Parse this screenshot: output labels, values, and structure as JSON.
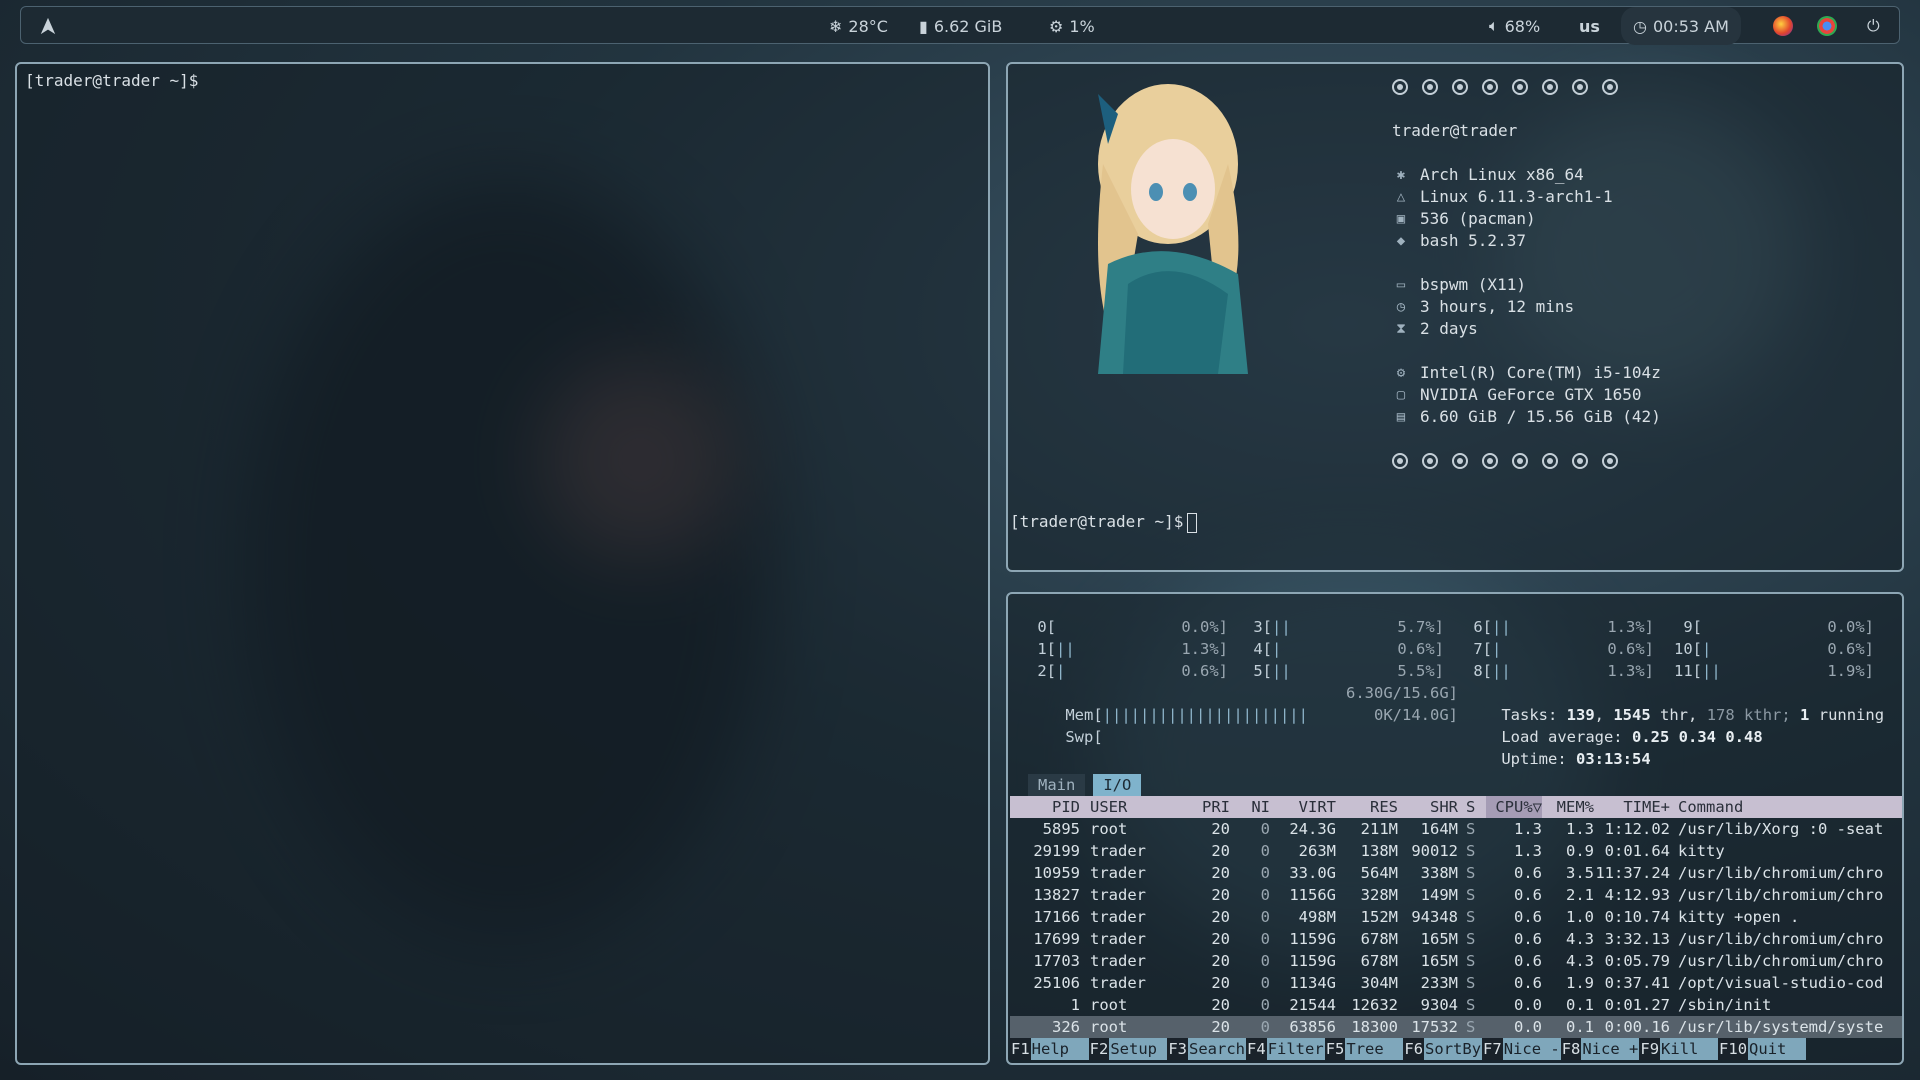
{
  "topbar": {
    "temperature": "28°C",
    "memory": "6.62 GiB",
    "cpu": "1%",
    "volume": "68%",
    "keyboard_layout": "us",
    "clock": "00:53 AM",
    "icons": [
      "arch-logo-icon",
      "snowflake-icon",
      "memory-icon",
      "cpu-icon",
      "volume-icon",
      "clock-icon",
      "firefox-icon",
      "chrome-icon",
      "power-icon"
    ]
  },
  "left_terminal": {
    "prompt": "[trader@trader ~]$"
  },
  "fetch": {
    "user_host": "trader@trader",
    "lines": [
      "Arch Linux x86_64",
      "Linux 6.11.3-arch1-1",
      "536 (pacman)",
      "bash 5.2.37",
      "bspwm (X11)",
      "3 hours, 12 mins",
      "2 days",
      "Intel(R) Core(TM) i5-104z",
      "NVIDIA GeForce GTX 1650",
      "6.60 GiB / 15.56 GiB (42)"
    ],
    "prompt": "[trader@trader ~]$"
  },
  "htop": {
    "cpus": [
      {
        "id": "0",
        "bars": "",
        "pct": "0.0%"
      },
      {
        "id": "1",
        "bars": "||",
        "pct": "1.3%"
      },
      {
        "id": "2",
        "bars": "|",
        "pct": "0.6%"
      },
      {
        "id": "3",
        "bars": "||",
        "pct": "5.7%"
      },
      {
        "id": "4",
        "bars": "|",
        "pct": "0.6%"
      },
      {
        "id": "5",
        "bars": "||",
        "pct": "5.5%"
      },
      {
        "id": "6",
        "bars": "||",
        "pct": "1.3%"
      },
      {
        "id": "7",
        "bars": "|",
        "pct": "0.6%"
      },
      {
        "id": "8",
        "bars": "||",
        "pct": "1.3%"
      },
      {
        "id": "9",
        "bars": "",
        "pct": "0.0%"
      },
      {
        "id": "10",
        "bars": "|",
        "pct": "0.6%"
      },
      {
        "id": "11",
        "bars": "||",
        "pct": "1.9%"
      }
    ],
    "mem_label": "Mem",
    "mem_bars": "||||||||||||||||||||||",
    "mem_value": "6.30G/15.6G",
    "swp_label": "Swp",
    "swp_value": "0K/14.0G",
    "tasks_prefix": "Tasks:",
    "tasks": "139",
    "thr": "1545",
    "thr_label": "thr,",
    "kthr": "178",
    "kthr_label": "kthr;",
    "running": "1",
    "running_label": "running",
    "load_label": "Load average:",
    "load": "0.25 0.34 0.48",
    "uptime_label": "Uptime:",
    "uptime": "03:13:54",
    "tabs": [
      "Main",
      "I/O"
    ],
    "columns": [
      "PID",
      "USER",
      "PRI",
      "NI",
      "VIRT",
      "RES",
      "SHR",
      "S",
      "CPU%▽",
      "MEM%",
      "TIME+",
      "Command"
    ],
    "processes": [
      {
        "pid": "5895",
        "user": "root",
        "pri": "20",
        "ni": "0",
        "virt": "24.3G",
        "res": "211M",
        "shr": "164M",
        "s": "S",
        "cpu": "1.3",
        "mem": "1.3",
        "time": "1:12.02",
        "cmd": "/usr/lib/Xorg :0 -seat"
      },
      {
        "pid": "29199",
        "user": "trader",
        "pri": "20",
        "ni": "0",
        "virt": "263M",
        "res": "138M",
        "shr": "90012",
        "s": "S",
        "cpu": "1.3",
        "mem": "0.9",
        "time": "0:01.64",
        "cmd": "kitty"
      },
      {
        "pid": "10959",
        "user": "trader",
        "pri": "20",
        "ni": "0",
        "virt": "33.0G",
        "res": "564M",
        "shr": "338M",
        "s": "S",
        "cpu": "0.6",
        "mem": "3.5",
        "time": "11:37.24",
        "cmd": "/usr/lib/chromium/chro"
      },
      {
        "pid": "13827",
        "user": "trader",
        "pri": "20",
        "ni": "0",
        "virt": "1156G",
        "res": "328M",
        "shr": "149M",
        "s": "S",
        "cpu": "0.6",
        "mem": "2.1",
        "time": "4:12.93",
        "cmd": "/usr/lib/chromium/chro"
      },
      {
        "pid": "17166",
        "user": "trader",
        "pri": "20",
        "ni": "0",
        "virt": "498M",
        "res": "152M",
        "shr": "94348",
        "s": "S",
        "cpu": "0.6",
        "mem": "1.0",
        "time": "0:10.74",
        "cmd": "kitty +open ."
      },
      {
        "pid": "17699",
        "user": "trader",
        "pri": "20",
        "ni": "0",
        "virt": "1159G",
        "res": "678M",
        "shr": "165M",
        "s": "S",
        "cpu": "0.6",
        "mem": "4.3",
        "time": "3:32.13",
        "cmd": "/usr/lib/chromium/chro"
      },
      {
        "pid": "17703",
        "user": "trader",
        "pri": "20",
        "ni": "0",
        "virt": "1159G",
        "res": "678M",
        "shr": "165M",
        "s": "S",
        "cpu": "0.6",
        "mem": "4.3",
        "time": "0:05.79",
        "cmd": "/usr/lib/chromium/chro"
      },
      {
        "pid": "25106",
        "user": "trader",
        "pri": "20",
        "ni": "0",
        "virt": "1134G",
        "res": "304M",
        "shr": "233M",
        "s": "S",
        "cpu": "0.6",
        "mem": "1.9",
        "time": "0:37.41",
        "cmd": "/opt/visual-studio-cod"
      },
      {
        "pid": "1",
        "user": "root",
        "pri": "20",
        "ni": "0",
        "virt": "21544",
        "res": "12632",
        "shr": "9304",
        "s": "S",
        "cpu": "0.0",
        "mem": "0.1",
        "time": "0:01.27",
        "cmd": "/sbin/init"
      },
      {
        "pid": "326",
        "user": "root",
        "pri": "20",
        "ni": "0",
        "virt": "63856",
        "res": "18300",
        "shr": "17532",
        "s": "S",
        "cpu": "0.0",
        "mem": "0.1",
        "time": "0:00.16",
        "cmd": "/usr/lib/systemd/syste"
      }
    ],
    "fkeys": [
      {
        "key": "F1",
        "label": "Help"
      },
      {
        "key": "F2",
        "label": "Setup"
      },
      {
        "key": "F3",
        "label": "Search"
      },
      {
        "key": "F4",
        "label": "Filter"
      },
      {
        "key": "F5",
        "label": "Tree"
      },
      {
        "key": "F6",
        "label": "SortBy"
      },
      {
        "key": "F7",
        "label": "Nice -"
      },
      {
        "key": "F8",
        "label": "Nice +"
      },
      {
        "key": "F9",
        "label": "Kill"
      },
      {
        "key": "F10",
        "label": "Quit"
      }
    ]
  }
}
